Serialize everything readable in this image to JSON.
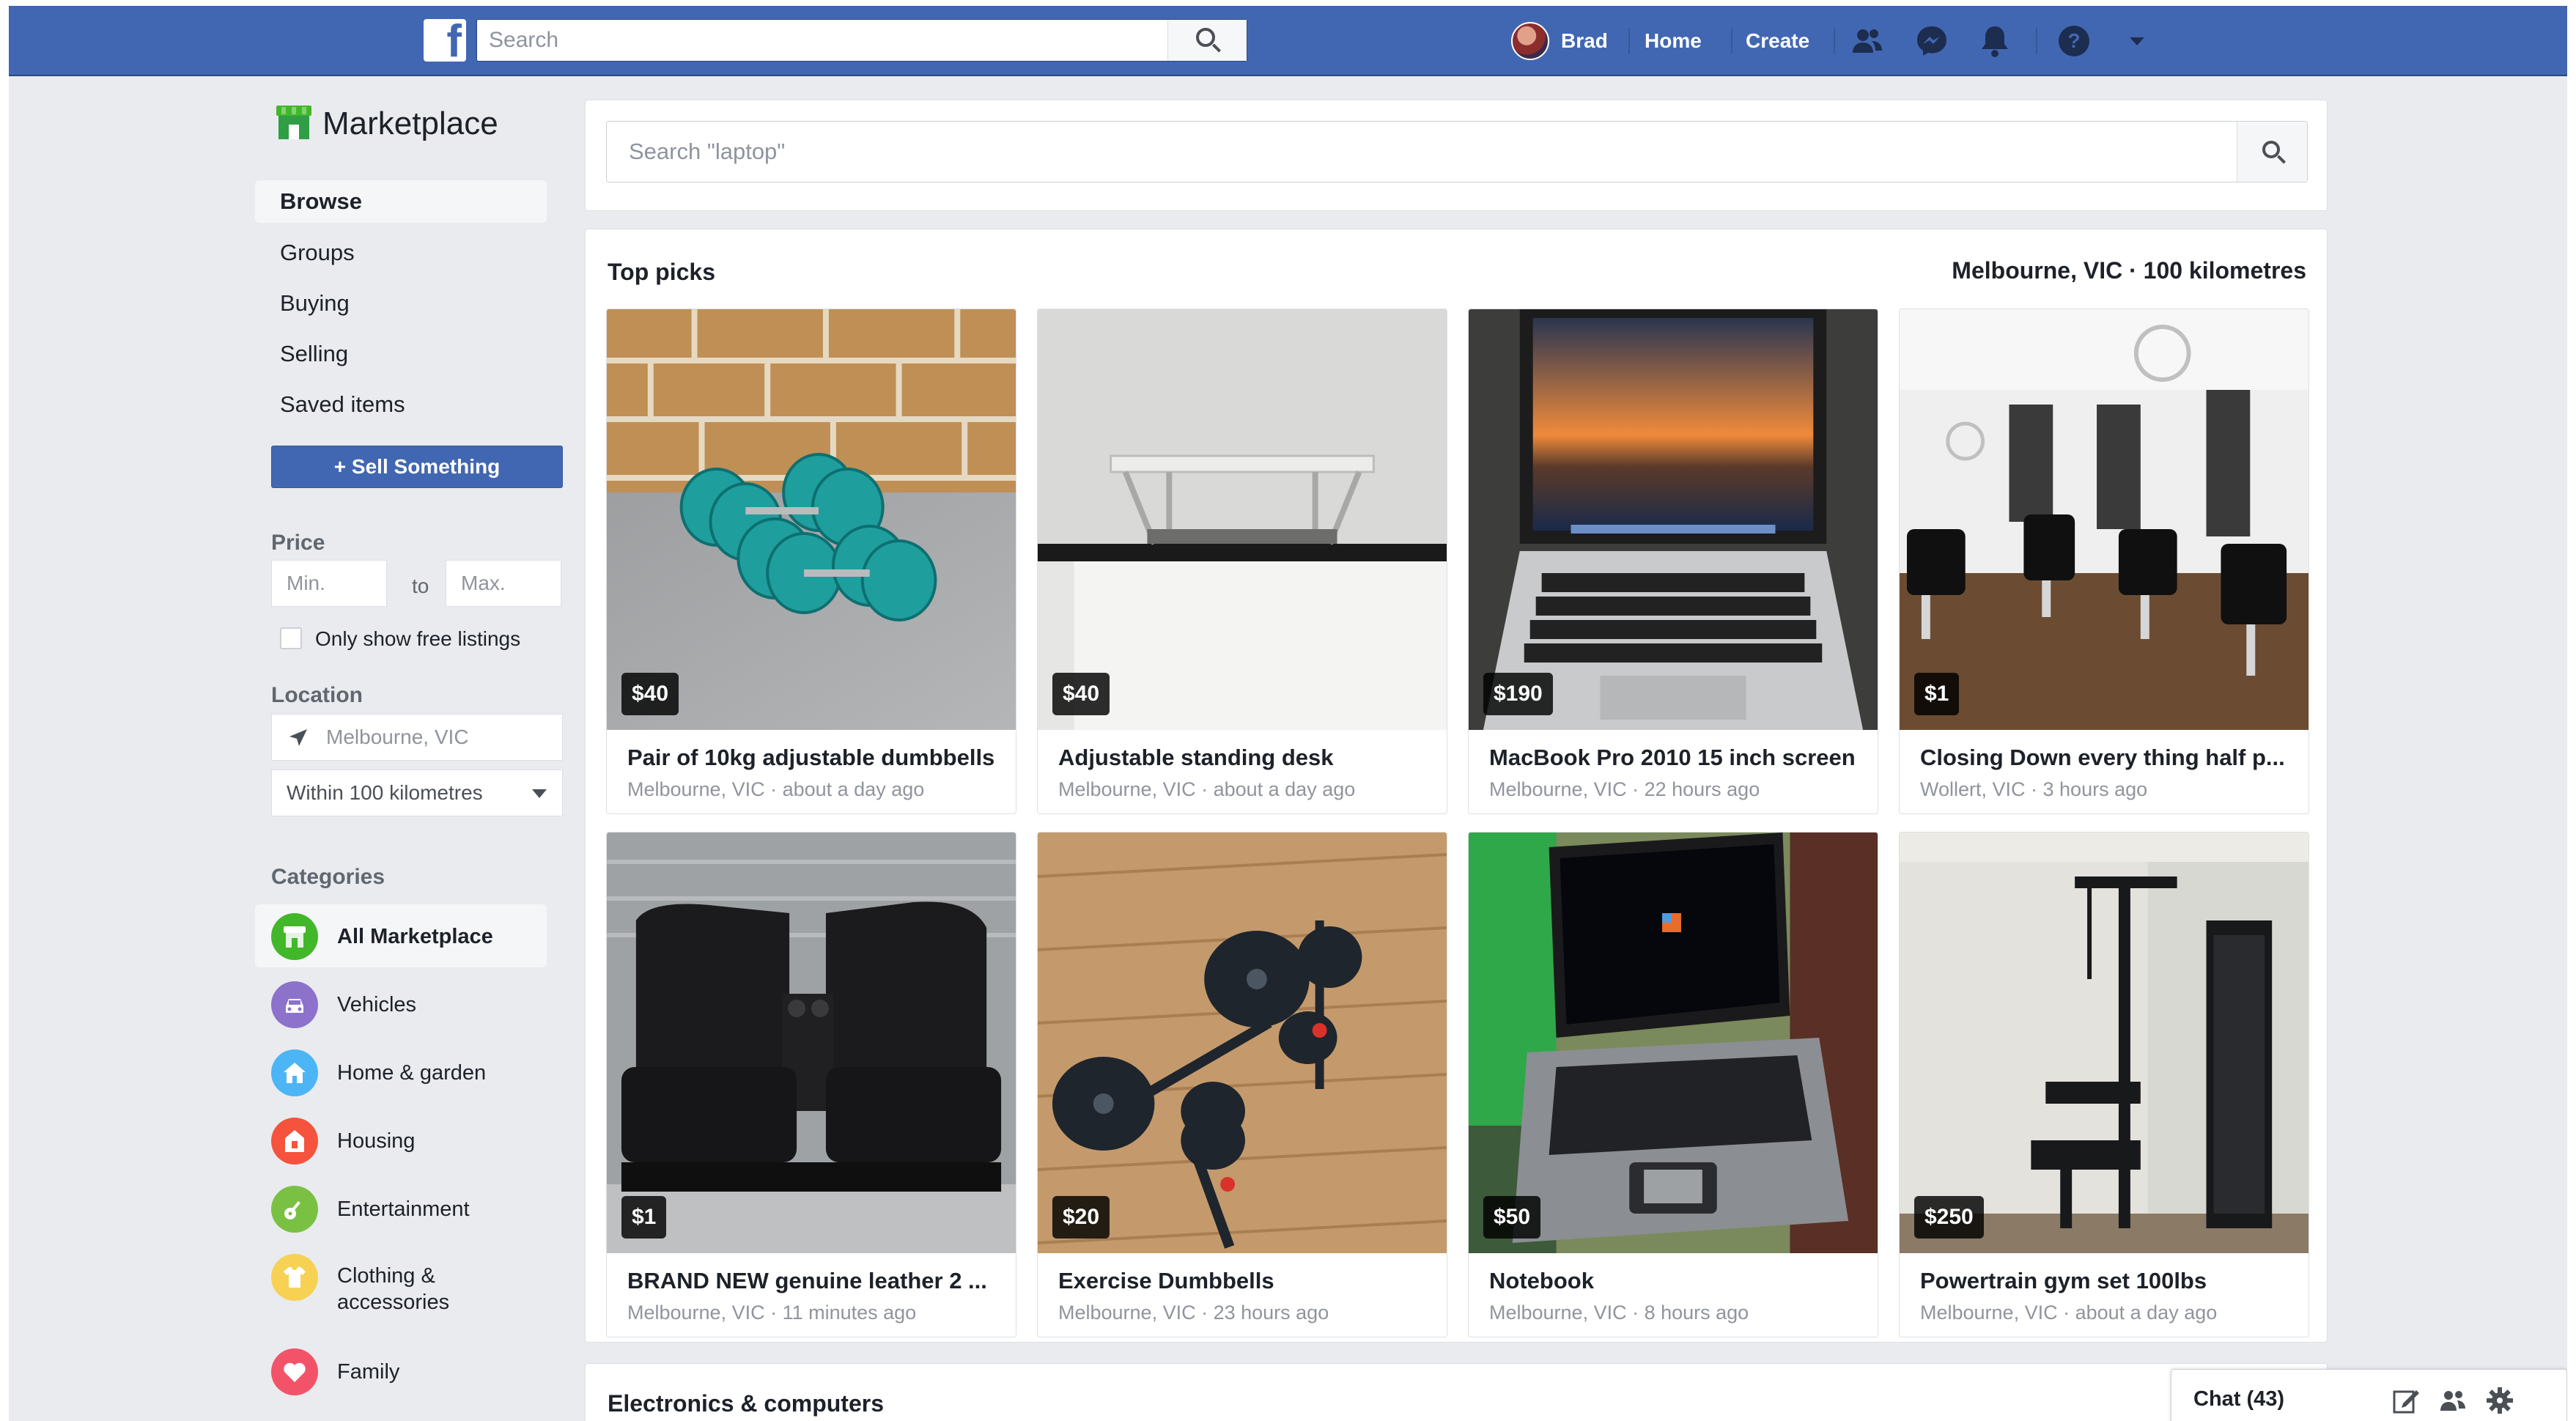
{
  "topbar": {
    "search_placeholder": "Search",
    "user_name": "Brad",
    "home_label": "Home",
    "create_label": "Create"
  },
  "sidebar": {
    "title": "Marketplace",
    "nav": [
      {
        "label": "Browse",
        "active": true
      },
      {
        "label": "Groups"
      },
      {
        "label": "Buying"
      },
      {
        "label": "Selling"
      },
      {
        "label": "Saved items"
      }
    ],
    "sell_button": "+ Sell Something",
    "price_heading": "Price",
    "price_min_placeholder": "Min.",
    "price_to": "to",
    "price_max_placeholder": "Max.",
    "free_listings_label": "Only show free listings",
    "location_heading": "Location",
    "location_value": "Melbourne, VIC",
    "radius_value": "Within 100 kilometres",
    "categories_heading": "Categories",
    "categories": [
      {
        "label": "All Marketplace",
        "icon": "storefront-icon",
        "color": "#42b72a",
        "active": true
      },
      {
        "label": "Vehicles",
        "icon": "car-icon",
        "color": "#8c72cb"
      },
      {
        "label": "Home & garden",
        "icon": "house-icon",
        "color": "#4cb5f5"
      },
      {
        "label": "Housing",
        "icon": "housing-icon",
        "color": "#f5533d"
      },
      {
        "label": "Entertainment",
        "icon": "guitar-icon",
        "color": "#7ac143"
      },
      {
        "label": "Clothing &\naccessories",
        "icon": "shirt-icon",
        "color": "#f7d154"
      },
      {
        "label": "Family",
        "icon": "heart-icon",
        "color": "#f35369"
      }
    ]
  },
  "main": {
    "search_placeholder": "Search \"laptop\"",
    "top_picks_title": "Top picks",
    "top_picks_location": "Melbourne, VIC · 100 kilometres",
    "items": [
      {
        "price": "$40",
        "title": "Pair of 10kg adjustable dumbbells",
        "subtitle": "Melbourne, VIC · about a day ago"
      },
      {
        "price": "$40",
        "title": "Adjustable standing desk",
        "subtitle": "Melbourne, VIC · about a day ago"
      },
      {
        "price": "$190",
        "title": "MacBook Pro 2010 15 inch screen",
        "subtitle": "Melbourne, VIC · 22 hours ago"
      },
      {
        "price": "$1",
        "title": "Closing Down every thing half p...",
        "subtitle": "Wollert, VIC · 3 hours ago"
      },
      {
        "price": "$1",
        "title": "BRAND NEW genuine leather 2 ...",
        "subtitle": "Melbourne, VIC · 11 minutes ago"
      },
      {
        "price": "$20",
        "title": "Exercise Dumbbells",
        "subtitle": "Melbourne, VIC · 23 hours ago"
      },
      {
        "price": "$50",
        "title": "Notebook",
        "subtitle": "Melbourne, VIC · 8 hours ago"
      },
      {
        "price": "$250",
        "title": "Powertrain gym set 100lbs",
        "subtitle": "Melbourne, VIC · about a day ago"
      }
    ],
    "electronics_title": "Electronics & computers"
  },
  "chat": {
    "label": "Chat (43)"
  },
  "colors": {
    "brand": "#4267b2",
    "background": "#e9ebee"
  }
}
